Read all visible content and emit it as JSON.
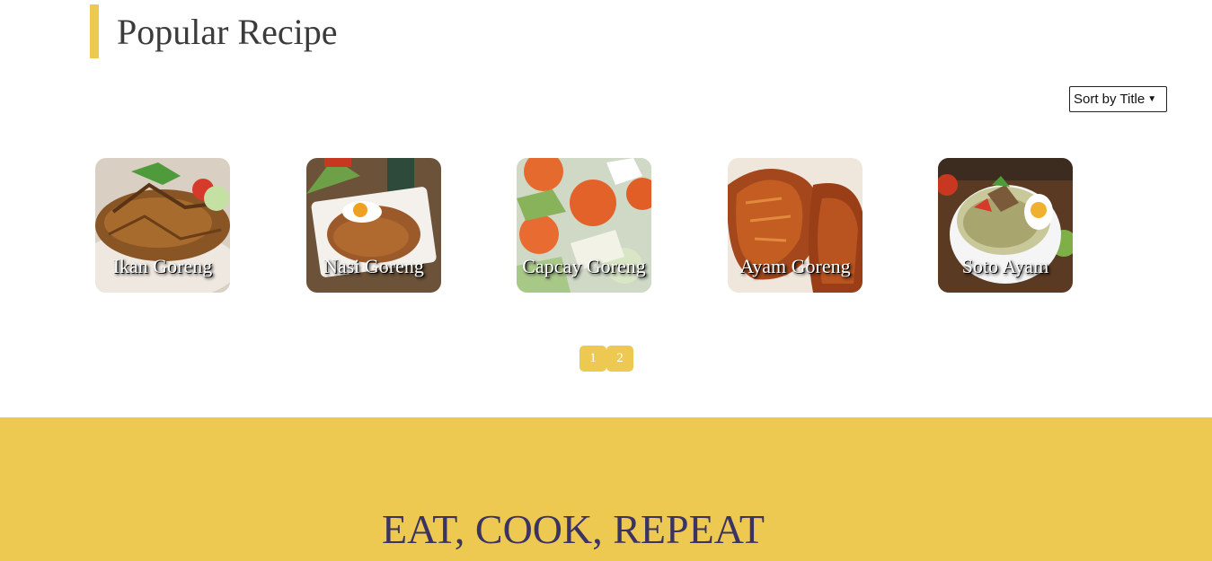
{
  "section": {
    "title": "Popular Recipe"
  },
  "sort": {
    "selected": "Sort by Title"
  },
  "recipes": [
    {
      "name": "Ikan Goreng",
      "icon": "fried-fish-photo"
    },
    {
      "name": "Nasi Goreng",
      "icon": "fried-rice-photo"
    },
    {
      "name": "Capcay Goreng",
      "icon": "stir-fried-vegetables-photo"
    },
    {
      "name": "Ayam Goreng",
      "icon": "fried-chicken-photo"
    },
    {
      "name": "Soto Ayam",
      "icon": "chicken-soup-photo"
    }
  ],
  "pagination": {
    "pages": [
      "1",
      "2"
    ]
  },
  "banner": {
    "heading": "EAT, COOK, REPEAT"
  },
  "colors": {
    "accent": "#edc951",
    "heading_dark": "#3b3462",
    "title_text": "#3b3b3b"
  }
}
